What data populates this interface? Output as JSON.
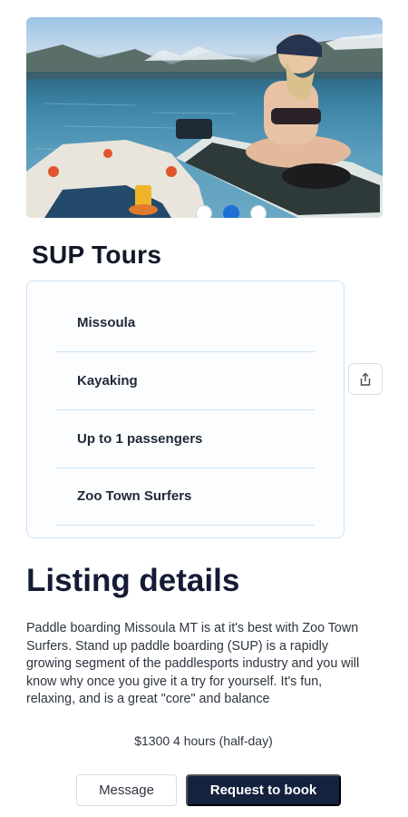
{
  "carousel": {
    "image_alt_icon": "photo-of-paddleboarder",
    "dots": [
      {
        "active": false
      },
      {
        "active": true
      },
      {
        "active": false
      }
    ]
  },
  "listing": {
    "title": "SUP Tours",
    "attributes": [
      {
        "label": "Missoula"
      },
      {
        "label": "Kayaking"
      },
      {
        "label": "Up to 1 passengers"
      },
      {
        "label": "Zoo Town Surfers"
      }
    ]
  },
  "details": {
    "heading": "Listing details",
    "description": "Paddle boarding Missoula MT is at it's best with Zoo Town Surfers. Stand up paddle boarding (SUP) is a rapidly growing segment of the paddlesports industry and you will know why once you give it a try for yourself. It's fun, relaxing, and is a great \"core\" and balance",
    "price_line": "$1300 4 hours (half-day)"
  },
  "actions": {
    "message_label": "Message",
    "book_label": "Request to book"
  },
  "icons": {
    "share": "share-icon"
  },
  "colors": {
    "accent": "#1f6fd6",
    "primary_button": "#15223d",
    "card_border": "#cfe2f7"
  }
}
